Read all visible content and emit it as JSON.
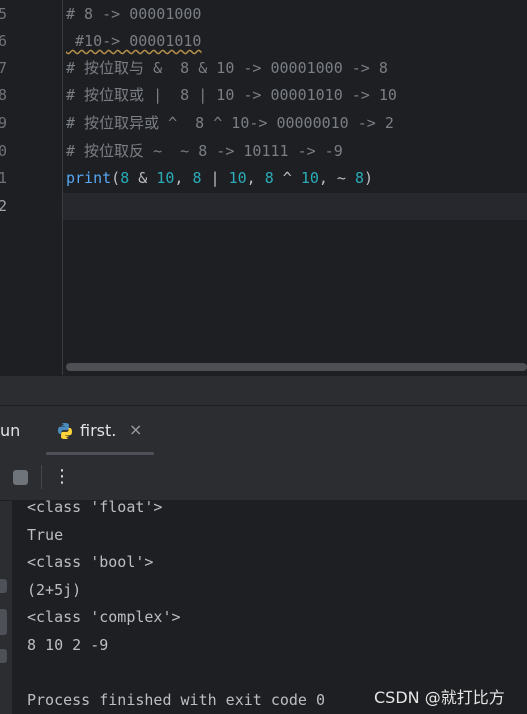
{
  "editor": {
    "line_numbers": [
      "5",
      "6",
      "7",
      "8",
      "9",
      "0",
      "1",
      "2"
    ],
    "lines": {
      "l5": "# 8 -> 00001000",
      "l6": " #10-> 00001010",
      "l7": "# 按位取与 &  8 & 10 -> 00001000 -> 8",
      "l8": "# 按位取或 |  8 | 10 -> 00001010 -> 10",
      "l9": "# 按位取异或 ^  8 ^ 10-> 00000010 -> 2",
      "l10": "# 按位取反 ~  ~ 8 -> 10111 -> -9",
      "l11": {
        "fn": "print",
        "p1": "(",
        "n1": "8",
        "p2": " & ",
        "n2": "10",
        "p3": ", ",
        "n3": "8",
        "p4": " | ",
        "n4": "10",
        "p5": ", ",
        "n5": "8",
        "p6": " ^ ",
        "n6": "10",
        "p7": ", ~ ",
        "n7": "8",
        "p8": ")"
      }
    }
  },
  "run_panel": {
    "label": "un",
    "tab_title": "first.",
    "close_glyph": "×",
    "more_glyph": "⋮"
  },
  "console": {
    "lines": [
      "<class 'float'>",
      "True",
      "<class 'bool'>",
      "(2+5j)",
      "<class 'complex'>",
      "8 10 2 -9",
      "",
      "Process finished with exit code 0"
    ]
  },
  "watermark": "CSDN @就打比方",
  "colors": {
    "editor_bg": "#1e1f22",
    "panel_bg": "#2b2d30",
    "comment": "#7a7e85",
    "number": "#2aacb8",
    "function": "#56a8f5",
    "text": "#bcbec4"
  }
}
